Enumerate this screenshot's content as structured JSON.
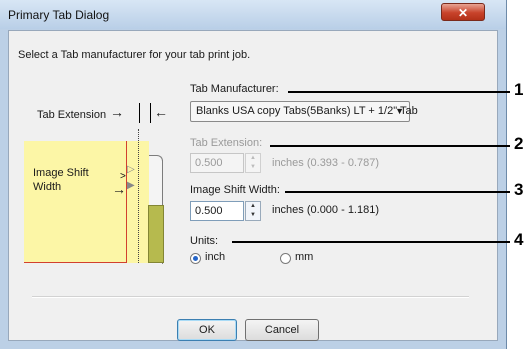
{
  "window": {
    "title": "Primary Tab Dialog",
    "close_glyph": "✕"
  },
  "instruction": "Select a Tab manufacturer for your tab print job.",
  "illustration": {
    "tab_extension_label": "Tab Extension",
    "image_shift_label_line1": "Image Shift",
    "image_shift_label_line2": "Width",
    "colors": {
      "paper": "#fcf6a6",
      "tab": "#b6ba4e",
      "guide": "#d2402e"
    }
  },
  "fields": {
    "tab_manufacturer": {
      "label": "Tab Manufacturer:",
      "value": "Blanks USA copy Tabs(5Banks) LT + 1/2\"  Tab"
    },
    "tab_extension": {
      "label": "Tab Extension:",
      "value": "0.500",
      "range": "inches (0.393 - 0.787)",
      "enabled": false
    },
    "image_shift_width": {
      "label": "Image Shift Width:",
      "value": "0.500",
      "range": "inches (0.000 - 1.181)"
    },
    "units": {
      "label": "Units:",
      "options": [
        {
          "label": "inch",
          "checked": true
        },
        {
          "label": "mm",
          "checked": false
        }
      ]
    }
  },
  "buttons": {
    "ok": "OK",
    "cancel": "Cancel"
  },
  "callouts": [
    "1",
    "2",
    "3",
    "4"
  ]
}
